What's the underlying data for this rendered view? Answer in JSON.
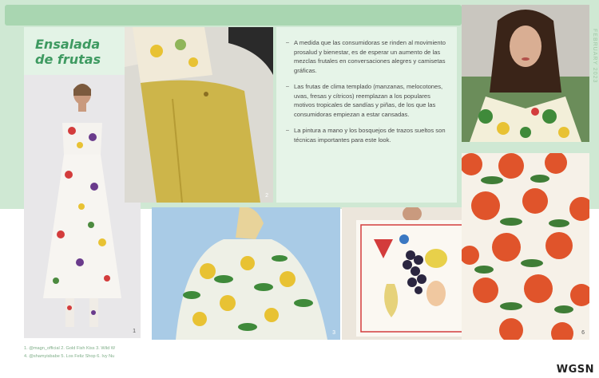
{
  "title": {
    "line1": "Ensalada",
    "line2": "de frutas"
  },
  "side_text": "FEBRUARY 2023",
  "bullets": [
    {
      "text": "A medida que las consumidoras se rinden al movimiento prosalud y bienestar, es de esperar un aumento de las mezclas frutales en conversaciones alegres y camisetas gráficas."
    },
    {
      "text": "Las frutas de clima templado (manzanas, melocotones, uvas, fresas y cítricos) reemplazan a los populares motivos tropicales de sandías y piñas, de los que las consumidoras empiezan a estar cansadas."
    },
    {
      "text": "La pintura a mano y los bosquejos de trazos sueltos son técnicas importantes para este look."
    }
  ],
  "photo_numbers": {
    "p1": "1",
    "p2": "2",
    "p3": "3",
    "p4": "4",
    "p5": "6"
  },
  "credits": {
    "line1": "1. @magn_official   2. Gold Fish Kiss   3. Wild W",
    "line2": "4. @shamyisbabe   5. Los Feliz Shop   6. Ivy Nu"
  },
  "brand": "WGSN",
  "colors": {
    "accent_green": "#3e9a61",
    "band_green": "#cfe8d3",
    "panel_green": "#e6f4e8"
  }
}
